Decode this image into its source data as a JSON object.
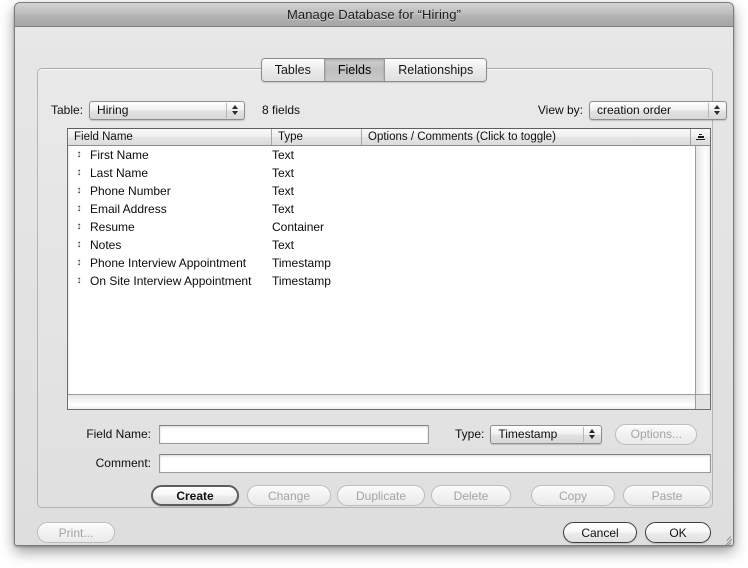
{
  "window": {
    "title": "Manage Database for “Hiring”"
  },
  "tabs": [
    {
      "label": "Tables",
      "active": false
    },
    {
      "label": "Fields",
      "active": true
    },
    {
      "label": "Relationships",
      "active": false
    }
  ],
  "toolbar": {
    "table_label": "Table:",
    "table_value": "Hiring",
    "field_count": "8 fields",
    "viewby_label": "View by:",
    "viewby_value": "creation order"
  },
  "list": {
    "columns": [
      {
        "key": "name",
        "label": "Field Name"
      },
      {
        "key": "type",
        "label": "Type"
      },
      {
        "key": "options",
        "label": "Options / Comments   (Click to toggle)"
      }
    ],
    "sort_icon": "stacked-sort-icon",
    "drag_handle_glyph": "↕",
    "rows": [
      {
        "name": "First Name",
        "type": "Text",
        "options": ""
      },
      {
        "name": "Last Name",
        "type": "Text",
        "options": ""
      },
      {
        "name": "Phone Number",
        "type": "Text",
        "options": ""
      },
      {
        "name": "Email Address",
        "type": "Text",
        "options": ""
      },
      {
        "name": "Resume",
        "type": "Container",
        "options": ""
      },
      {
        "name": "Notes",
        "type": "Text",
        "options": ""
      },
      {
        "name": "Phone Interview Appointment",
        "type": "Timestamp",
        "options": ""
      },
      {
        "name": "On Site Interview Appointment",
        "type": "Timestamp",
        "options": ""
      }
    ]
  },
  "form": {
    "fieldname_label": "Field Name:",
    "fieldname_value": "",
    "fieldname_placeholder": "",
    "comment_label": "Comment:",
    "comment_value": "",
    "comment_placeholder": "",
    "type_label": "Type:",
    "type_value": "Timestamp",
    "options_button": "Options..."
  },
  "actions": [
    {
      "label": "Create",
      "state": "default"
    },
    {
      "label": "Change",
      "state": "disabled"
    },
    {
      "label": "Duplicate",
      "state": "disabled"
    },
    {
      "label": "Delete",
      "state": "disabled"
    },
    {
      "label": "Copy",
      "state": "disabled"
    },
    {
      "label": "Paste",
      "state": "disabled"
    }
  ],
  "footer": {
    "print_label": "Print...",
    "cancel_label": "Cancel",
    "ok_label": "OK"
  }
}
